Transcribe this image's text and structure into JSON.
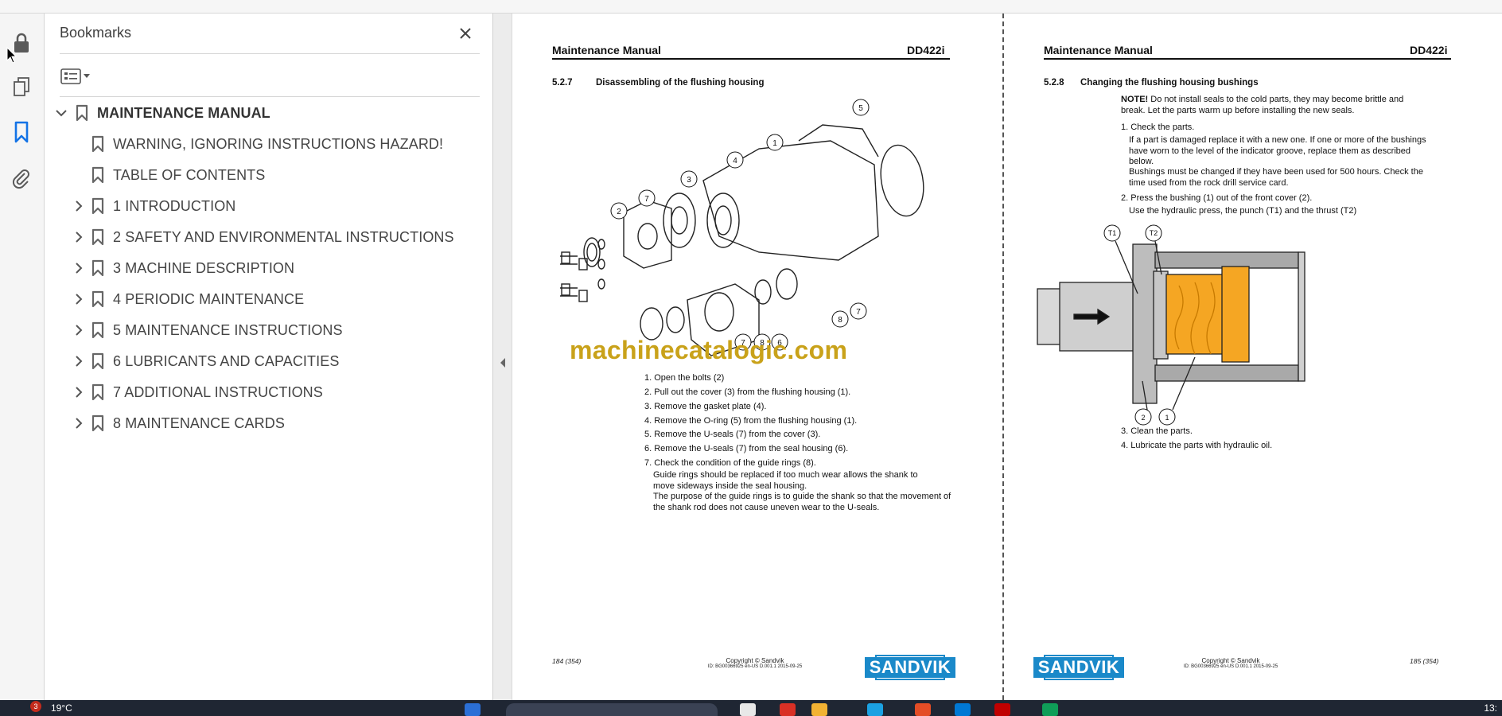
{
  "sidebar_panel": {
    "title": "Bookmarks",
    "items": [
      {
        "label": "MAINTENANCE MANUAL",
        "expanded": true,
        "level": 0
      },
      {
        "label": "WARNING, IGNORING INSTRUCTIONS HAZARD!",
        "level": 1,
        "has_children": false
      },
      {
        "label": "TABLE OF CONTENTS",
        "level": 1,
        "has_children": false
      },
      {
        "label": "1 INTRODUCTION",
        "level": 1,
        "has_children": true
      },
      {
        "label": "2 SAFETY AND ENVIRONMENTAL INSTRUCTIONS",
        "level": 1,
        "has_children": true
      },
      {
        "label": "3 MACHINE DESCRIPTION",
        "level": 1,
        "has_children": true
      },
      {
        "label": "4 PERIODIC MAINTENANCE",
        "level": 1,
        "has_children": true
      },
      {
        "label": "5 MAINTENANCE INSTRUCTIONS",
        "level": 1,
        "has_children": true
      },
      {
        "label": "6 LUBRICANTS AND CAPACITIES",
        "level": 1,
        "has_children": true
      },
      {
        "label": "7 ADDITIONAL INSTRUCTIONS",
        "level": 1,
        "has_children": true
      },
      {
        "label": "8 MAINTENANCE CARDS",
        "level": 1,
        "has_children": true
      }
    ]
  },
  "icons": {
    "rail": [
      "lock-icon",
      "pages-icon",
      "bookmark-icon",
      "attachment-icon"
    ],
    "active_rail": "bookmark-icon"
  },
  "colors": {
    "accent": "#1473e6",
    "highlight_orange": "#f5a623",
    "sandvik_blue": "#1a89c9",
    "watermark": "#c9a21a"
  },
  "left_page": {
    "header_title": "Maintenance Manual",
    "header_model": "DD422i",
    "section_number": "5.2.7",
    "section_title": "Disassembling of the flushing housing",
    "callouts": [
      "5",
      "1",
      "4",
      "3",
      "2",
      "7",
      "8",
      "7",
      "7",
      "8",
      "6"
    ],
    "watermark": "machinecatalogic.com",
    "steps": [
      "1. Open the bolts (2)",
      "2. Pull out the cover (3) from the flushing housing (1).",
      "3. Remove the gasket plate (4).",
      "4. Remove the O-ring (5) from the flushing housing (1).",
      "5. Remove the U-seals (7) from the cover (3).",
      "6. Remove the U-seals (7) from the seal housing (6).",
      "7. Check the condition of the guide rings (8)."
    ],
    "step7_note_1": "Guide rings should be replaced if too much wear allows the shank to move sideways inside the seal housing.",
    "step7_note_2": "The purpose of the guide rings is to guide the shank so that the movement of the shank rod does not cause uneven wear to the U-seals.",
    "footer_page": "184 (354)",
    "footer_copyright": "Copyright © Sandvik",
    "footer_id": "ID: BG00366925 en-US D.001.1 2015-09-25",
    "logo": "SANDVIK"
  },
  "right_page": {
    "header_title": "Maintenance Manual",
    "header_model": "DD422i",
    "section_number": "5.2.8",
    "section_title": "Changing the flushing housing bushings",
    "note_label": "NOTE!",
    "note_text": " Do not install seals to the cold parts, they may become brittle and break. Let the parts warm up before installing the new seals.",
    "step1": "1. Check the parts.",
    "step1_detail_1": "If a part is damaged replace it with a new one. If one or more of the bushings have worn to the level of the indicator groove, replace them as described below.",
    "step1_detail_2": "Bushings must be changed if they have been used for 500 hours. Check the time used from the rock drill service card.",
    "step2": "2. Press the bushing (1) out of the front cover (2).",
    "step2_detail": "Use the hydraulic press, the punch (T1) and the thrust (T2)",
    "figure_labels": [
      "T1",
      "T2",
      "2",
      "1"
    ],
    "step3": "3. Clean the parts.",
    "step4": "4. Lubricate the parts with hydraulic oil.",
    "footer_page": "185 (354)",
    "footer_copyright": "Copyright © Sandvik",
    "footer_id": "ID: BG00366925 en-US D.001.1 2015-09-25",
    "logo": "SANDVIK"
  },
  "taskbar": {
    "weather": "19°C",
    "notification_count": "3",
    "clock": "13:"
  }
}
